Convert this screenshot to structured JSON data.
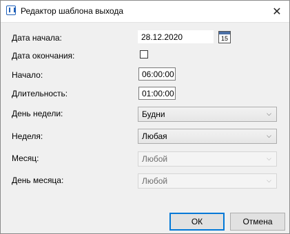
{
  "window": {
    "title": "Редактор шаблона выхода",
    "close_glyph": "✕"
  },
  "form": {
    "start_date_label": "Дата начала:",
    "start_date_value": "28.12.2020",
    "calendar_icon_text": "15",
    "end_date_label": "Дата окончания:",
    "end_date_checked": false,
    "start_label": "Начало:",
    "start_value": "06:00:00",
    "duration_label": "Длительность:",
    "duration_value": "01:00:00",
    "weekday_label": "День недели:",
    "weekday_value": "Будни",
    "week_label": "Неделя:",
    "week_value": "Любая",
    "month_label": "Месяц:",
    "month_value": "Любой",
    "day_of_month_label": "День месяца:",
    "day_of_month_value": "Любой"
  },
  "buttons": {
    "ok": "ОК",
    "cancel": "Отмена"
  },
  "icons": {
    "app": "app-logo-icon",
    "calendar": "calendar-icon",
    "dropdown": "chevron-down-icon"
  },
  "colors": {
    "accent": "#0078d7",
    "dialog_bg": "#f0f0f0"
  }
}
